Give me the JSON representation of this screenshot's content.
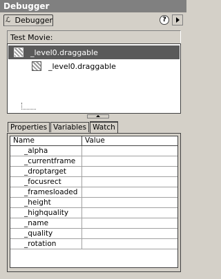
{
  "window": {
    "title": "Debugger"
  },
  "toolbar": {
    "tab_label": "Debugger",
    "help_glyph": "?"
  },
  "movie": {
    "label": "Test Movie:"
  },
  "tree": {
    "items": [
      {
        "label": "_level0.draggable"
      },
      {
        "label": "_level0.draggable"
      }
    ]
  },
  "tabs": [
    {
      "label": "Properties"
    },
    {
      "label": "Variables"
    },
    {
      "label": "Watch"
    }
  ],
  "active_tab": "Watch",
  "grid": {
    "headers": {
      "name": "Name",
      "value": "Value"
    },
    "rows": [
      {
        "name": "_alpha",
        "value": ""
      },
      {
        "name": "_currentframe",
        "value": ""
      },
      {
        "name": "_droptarget",
        "value": ""
      },
      {
        "name": "_focusrect",
        "value": ""
      },
      {
        "name": "_framesloaded",
        "value": ""
      },
      {
        "name": "_height",
        "value": ""
      },
      {
        "name": "_highquality",
        "value": ""
      },
      {
        "name": "_name",
        "value": ""
      },
      {
        "name": "_quality",
        "value": ""
      },
      {
        "name": "_rotation",
        "value": ""
      }
    ]
  }
}
